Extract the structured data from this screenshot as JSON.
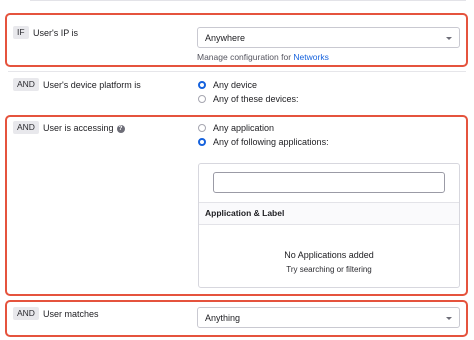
{
  "rule_ip": {
    "keyword": "IF",
    "label": "User's IP is",
    "select_value": "Anywhere",
    "helper_prefix": "Manage configuration for",
    "helper_link": "Networks"
  },
  "rule_device": {
    "keyword": "AND",
    "label": "User's device platform is",
    "options": [
      {
        "label": "Any device",
        "selected": true
      },
      {
        "label": "Any of these devices:",
        "selected": false
      }
    ]
  },
  "rule_access": {
    "keyword": "AND",
    "label": "User is accessing",
    "options": [
      {
        "label": "Any application",
        "selected": false
      },
      {
        "label": "Any of following applications:",
        "selected": true
      }
    ],
    "apps": {
      "search_value": "",
      "column_header": "Application & Label",
      "empty_title": "No Applications added",
      "empty_subtitle": "Try searching or filtering"
    }
  },
  "rule_user": {
    "keyword": "AND",
    "label": "User matches",
    "select_value": "Anything"
  },
  "colors": {
    "highlight": "#e5533d",
    "accent": "#1662dd",
    "link": "#1662dd"
  }
}
